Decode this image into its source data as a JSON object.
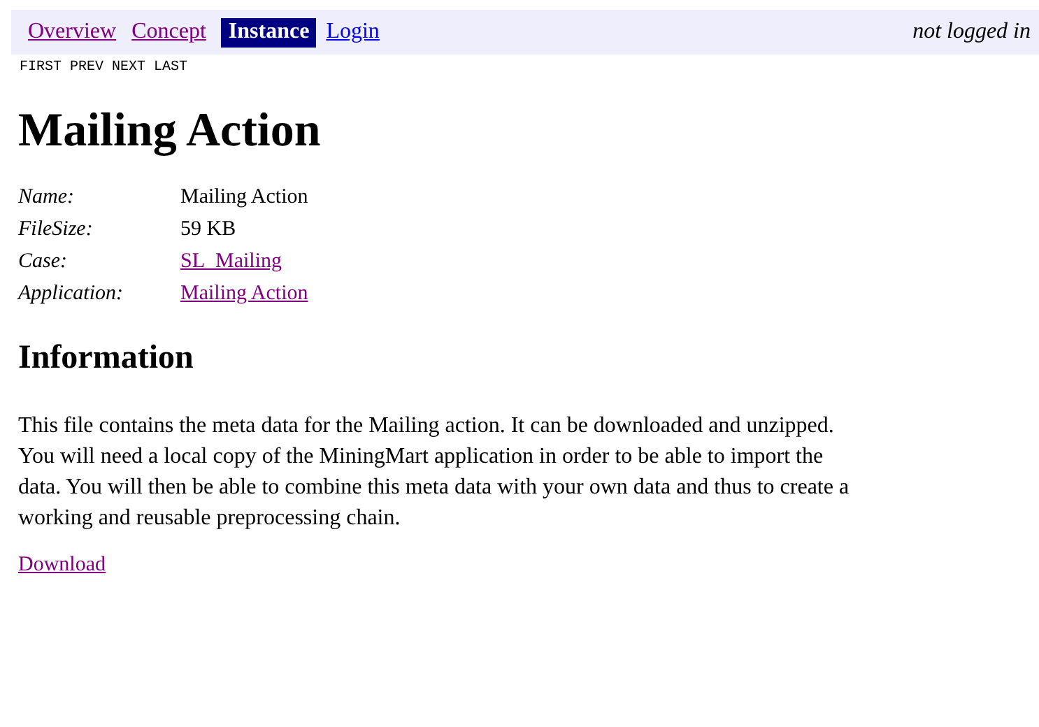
{
  "nav": {
    "links": [
      {
        "label": "Overview",
        "selected": false,
        "visited": true
      },
      {
        "label": "Concept",
        "selected": false,
        "visited": true
      },
      {
        "label": "Instance",
        "selected": true
      },
      {
        "label": "Login",
        "selected": false,
        "visited": false
      }
    ],
    "status": "not logged in"
  },
  "pager": [
    "FIRST",
    "PREV",
    "NEXT",
    "LAST"
  ],
  "title": "Mailing Action",
  "properties": [
    {
      "label": "Name:",
      "value": "Mailing Action",
      "kind": "text"
    },
    {
      "label": "FileSize:",
      "value": "59 KB",
      "kind": "text"
    },
    {
      "label": "Case:",
      "value": "SL_Mailing",
      "kind": "link"
    },
    {
      "label": "Application:",
      "value": "Mailing Action",
      "kind": "link"
    }
  ],
  "section": {
    "heading": "Information",
    "text": "This file contains the meta data for the Mailing action. It can be downloaded and unzipped. You will need a local copy of the MiningMart application in order to be able to import the data. You will then be able to combine this meta data with your own data and thus to create a working and reusable preprocessing chain."
  },
  "download": "Download"
}
